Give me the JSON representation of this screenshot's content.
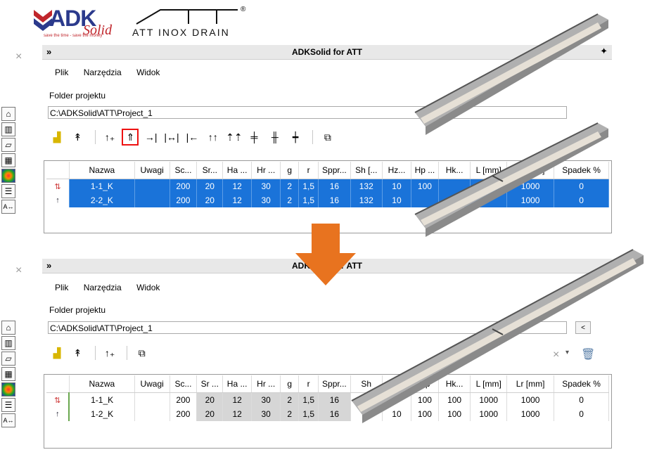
{
  "logos": {
    "adk_name": "ADK",
    "adk_solid": "Solid",
    "adk_tagline": "save the time - save the money",
    "att_name": "ATT INOX DRAIN",
    "att_reg": "®"
  },
  "panel_top": {
    "close": "×",
    "collapse": "»",
    "title": "ADKSolid for ATT",
    "menu": [
      "Plik",
      "Narzędzia",
      "Widok"
    ],
    "folder_label": "Folder projektu",
    "folder_path": "C:\\ADKSolid\\ATT\\Project_1",
    "columns": [
      "Nazwa",
      "Uwagi",
      "Sc...",
      "Sr...",
      "Ha ...",
      "Hr ...",
      "g",
      "r",
      "Sppr...",
      "Sh [...",
      "Hz...",
      "Hp ...",
      "Hk...",
      "L [mm]",
      "Lr [mm]",
      "Spadek %"
    ],
    "rows": [
      {
        "name": "1-1_K",
        "uwagi": "",
        "sc": "200",
        "sr": "20",
        "ha": "12",
        "hr": "30",
        "g": "2",
        "r": "1,5",
        "sppr": "16",
        "sh": "132",
        "hz": "10",
        "hp": "100",
        "hk": "",
        "l": "",
        "lr": "1000",
        "spadek": "0"
      },
      {
        "name": "2-2_K",
        "uwagi": "",
        "sc": "200",
        "sr": "20",
        "ha": "12",
        "hr": "30",
        "g": "2",
        "r": "1,5",
        "sppr": "16",
        "sh": "132",
        "hz": "10",
        "hp": "",
        "hk": "",
        "l": "",
        "lr": "1000",
        "spadek": "0"
      }
    ]
  },
  "panel_bottom": {
    "close": "×",
    "collapse": "»",
    "title": "ADKSolid for ATT",
    "menu": [
      "Plik",
      "Narzędzia",
      "Widok"
    ],
    "folder_label": "Folder projektu",
    "folder_path": "C:\\ADKSolid\\ATT\\Project_1",
    "browse": "<",
    "columns": [
      "Nazwa",
      "Uwagi",
      "Sc...",
      "Sr ...",
      "Ha ...",
      "Hr ...",
      "g",
      "r",
      "Sppr...",
      "Sh",
      "Hz",
      "Hp",
      "Hk...",
      "L [mm]",
      "Lr [mm]",
      "Spadek %"
    ],
    "rows": [
      {
        "name": "1-1_K",
        "uwagi": "",
        "sc": "200",
        "sr": "20",
        "ha": "12",
        "hr": "30",
        "g": "2",
        "r": "1,5",
        "sppr": "16",
        "sh": "",
        "hz": "",
        "hp": "100",
        "hk": "100",
        "l": "1000",
        "lr": "1000",
        "spadek": "0"
      },
      {
        "name": "1-2_K",
        "uwagi": "",
        "sc": "200",
        "sr": "20",
        "ha": "12",
        "hr": "30",
        "g": "2",
        "r": "1,5",
        "sppr": "16",
        "sh": "",
        "hz": "10",
        "hp": "100",
        "hk": "100",
        "l": "1000",
        "lr": "1000",
        "spadek": "0"
      }
    ],
    "delete_icon": "×"
  },
  "colors": {
    "selection": "#1a73d9",
    "arrow": "#e8731f",
    "highlight_box": "#e11111"
  },
  "icons": [
    "home-icon",
    "cube-icon",
    "folder-icon",
    "chart-icon",
    "color-wheel-icon",
    "list-icon",
    "text-icon"
  ]
}
